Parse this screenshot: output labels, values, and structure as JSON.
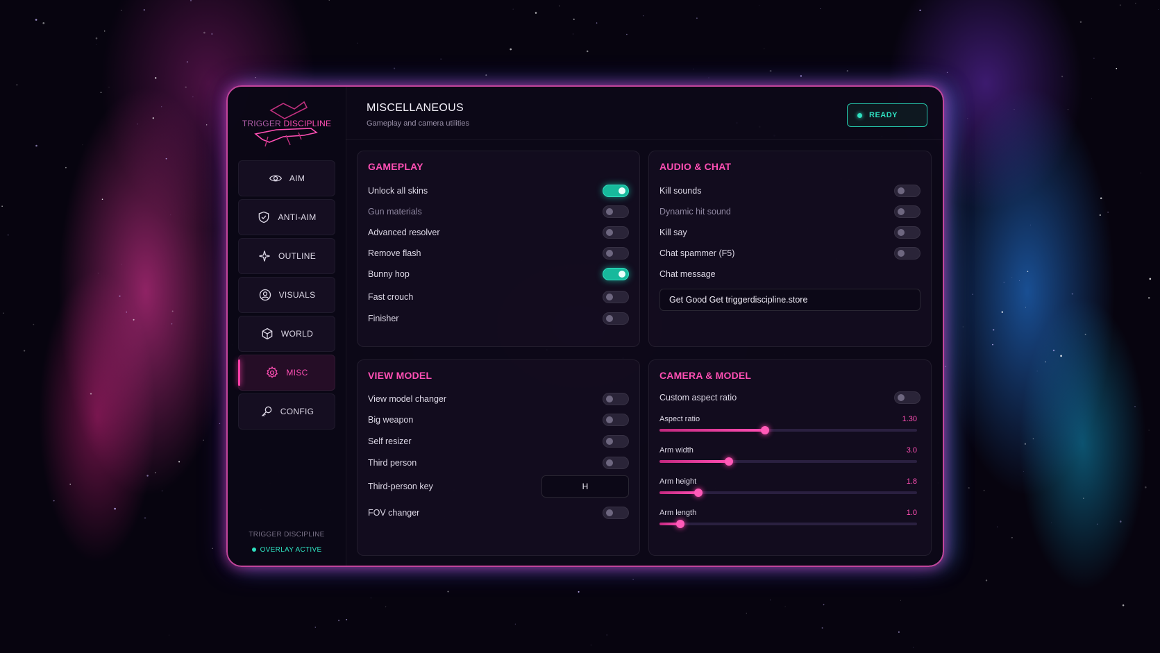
{
  "brand": {
    "logo_word1": "TRIGGER",
    "logo_word2": "DISCIPLINE",
    "footer": "TRIGGER DISCIPLINE",
    "status": "OVERLAY ACTIVE"
  },
  "nav": [
    {
      "label": "AIM",
      "icon": "eye-icon"
    },
    {
      "label": "ANTI-AIM",
      "icon": "shield-icon"
    },
    {
      "label": "OUTLINE",
      "icon": "sparkle-icon"
    },
    {
      "label": "VISUALS",
      "icon": "user-circle-icon"
    },
    {
      "label": "WORLD",
      "icon": "cube-icon"
    },
    {
      "label": "MISC",
      "icon": "gear-icon",
      "active": true
    },
    {
      "label": "CONFIG",
      "icon": "key-icon"
    }
  ],
  "header": {
    "title": "MISCELLANEOUS",
    "subtitle": "Gameplay and camera utilities",
    "status": "READY"
  },
  "gameplay": {
    "title": "GAMEPLAY",
    "rows": [
      {
        "label": "Unlock all skins",
        "on": true
      },
      {
        "label": "Gun materials",
        "on": false,
        "dim": true
      },
      {
        "label": "Advanced resolver",
        "on": false
      },
      {
        "label": "Remove flash",
        "on": false
      },
      {
        "label": "Bunny hop",
        "on": true
      },
      {
        "label": "Fast crouch",
        "on": false
      },
      {
        "label": "Finisher",
        "on": false
      }
    ]
  },
  "audio": {
    "title": "AUDIO & CHAT",
    "rows": [
      {
        "label": "Kill sounds",
        "on": false
      },
      {
        "label": "Dynamic hit sound",
        "on": false,
        "dim": true
      },
      {
        "label": "Kill say",
        "on": false
      },
      {
        "label": "Chat spammer (F5)",
        "on": false
      }
    ],
    "message_label": "Chat message",
    "message_value": "Get Good Get triggerdiscipline.store"
  },
  "viewmodel": {
    "title": "VIEW MODEL",
    "rows": [
      {
        "label": "View model changer",
        "on": false
      },
      {
        "label": "Big weapon",
        "on": false
      },
      {
        "label": "Self resizer",
        "on": false
      },
      {
        "label": "Third person",
        "on": false
      }
    ],
    "key_label": "Third-person key",
    "key_value": "H",
    "fov_label": "FOV changer",
    "fov_on": false
  },
  "camera": {
    "title": "CAMERA & MODEL",
    "aspect_toggle_label": "Custom aspect ratio",
    "aspect_toggle_on": false,
    "sliders": [
      {
        "label": "Aspect ratio",
        "value": "1.30",
        "fraction": 0.41
      },
      {
        "label": "Arm width",
        "value": "3.0",
        "fraction": 0.27
      },
      {
        "label": "Arm height",
        "value": "1.8",
        "fraction": 0.15
      },
      {
        "label": "Arm length",
        "value": "1.0",
        "fraction": 0.08
      }
    ]
  },
  "colors": {
    "accent": "#ff4fb4",
    "active": "#2fe0c0"
  }
}
